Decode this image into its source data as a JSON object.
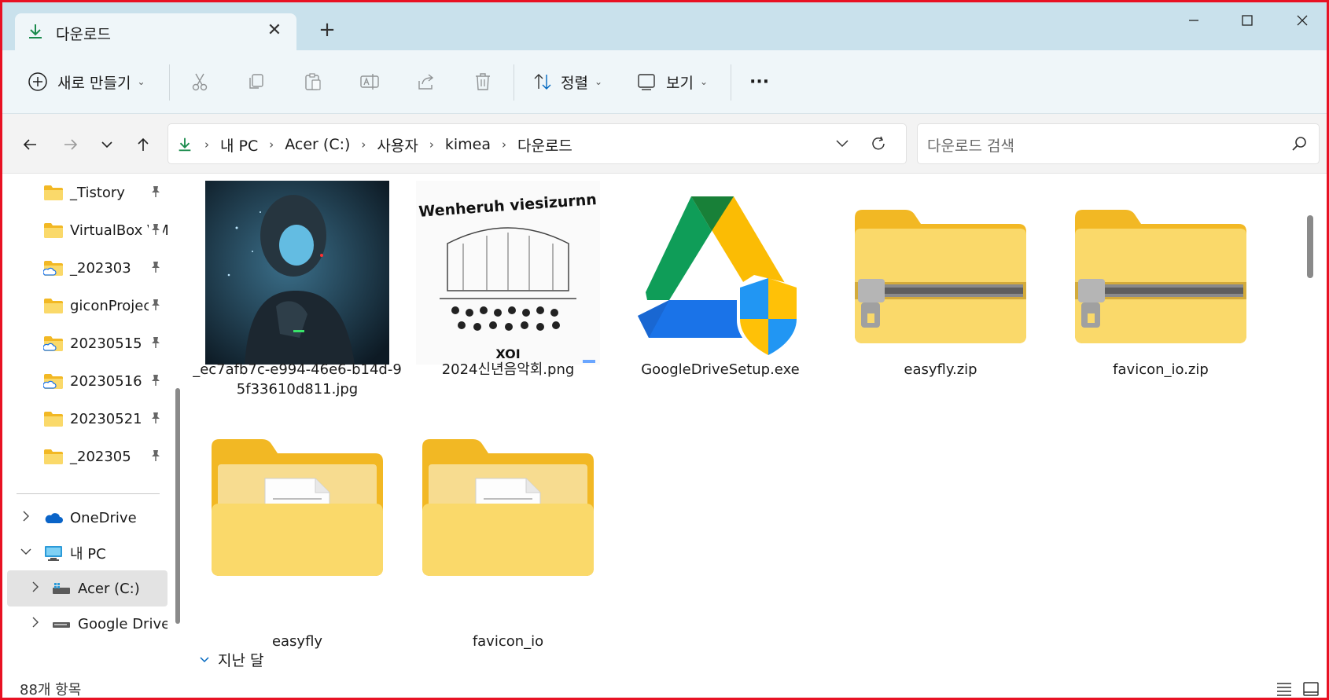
{
  "tab": {
    "title": "다운로드",
    "close": "✕"
  },
  "new_tab": "+",
  "window": {
    "minimize": "—",
    "maximize": "☐",
    "close": "✕"
  },
  "toolbar": {
    "new_label": "새로 만들기",
    "sort_label": "정렬",
    "view_label": "보기",
    "more_label": "···"
  },
  "address": {
    "crumbs": [
      "내 PC",
      "Acer (C:)",
      "사용자",
      "kimea",
      "다운로드"
    ],
    "separator": "›"
  },
  "search": {
    "placeholder": "다운로드 검색"
  },
  "sidebar": {
    "quick": [
      {
        "label": "_Tistory",
        "cloud": false
      },
      {
        "label": "VirtualBox VMs",
        "cloud": false
      },
      {
        "label": "_202303",
        "cloud": true
      },
      {
        "label": "giconProject",
        "cloud": false
      },
      {
        "label": "20230515",
        "cloud": true
      },
      {
        "label": "20230516",
        "cloud": true
      },
      {
        "label": "20230521",
        "cloud": false
      },
      {
        "label": "_202305",
        "cloud": false
      }
    ],
    "onedrive": "OneDrive",
    "this_pc": "내 PC",
    "drive_c": "Acer (C:)",
    "google_drive": "Google Drive (G:)"
  },
  "files": [
    {
      "name": "_ec7afb7c-e994-46e6-b14d-95f33610d811.jpg",
      "kind": "image-robot"
    },
    {
      "name": "2024신년음악회.png",
      "kind": "image-sketch",
      "sketch_text_top": "Wenheruh viesizurnn",
      "sketch_text_bottom": "XOI"
    },
    {
      "name": "GoogleDriveSetup.exe",
      "kind": "exe"
    },
    {
      "name": "easyfly.zip",
      "kind": "zip"
    },
    {
      "name": "favicon_io.zip",
      "kind": "zip"
    },
    {
      "name": "easyfly",
      "kind": "folder"
    },
    {
      "name": "favicon_io",
      "kind": "folder"
    }
  ],
  "group": {
    "label": "지난 달"
  },
  "status": {
    "count": "88개 항목"
  },
  "colors": {
    "accent": "#0067c0",
    "folder": "#f5c74a",
    "frame": "#e81123"
  }
}
